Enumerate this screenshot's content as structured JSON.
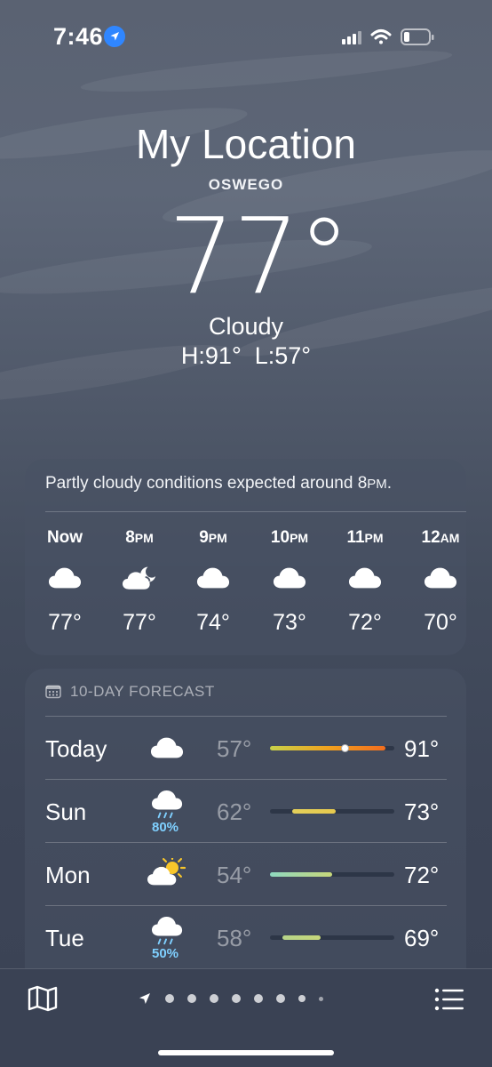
{
  "status_bar": {
    "time": "7:46",
    "location_icon": "location-arrow-icon",
    "signal_icon": "cellular-signal-icon",
    "wifi_icon": "wifi-icon",
    "battery_icon": "battery-low-icon"
  },
  "header": {
    "title": "My Location",
    "subtitle": "OSWEGO",
    "temperature": "77°",
    "condition": "Cloudy",
    "hi_lo": "H:91°  L:57°"
  },
  "hourly": {
    "summary": "Partly cloudy conditions expected around 8PM.",
    "hours": [
      {
        "label": "Now",
        "icon": "cloud-icon",
        "temp": "77°"
      },
      {
        "label": "8PM",
        "icon": "cloud-moon-icon",
        "temp": "77°"
      },
      {
        "label": "9PM",
        "icon": "cloud-icon",
        "temp": "74°"
      },
      {
        "label": "10PM",
        "icon": "cloud-icon",
        "temp": "73°"
      },
      {
        "label": "11PM",
        "icon": "cloud-icon",
        "temp": "72°"
      },
      {
        "label": "12AM",
        "icon": "cloud-icon",
        "temp": "70°"
      }
    ]
  },
  "forecast": {
    "header": "10-DAY FORECAST",
    "days": [
      {
        "day": "Today",
        "icon": "cloud-icon",
        "precip": "",
        "low": "57°",
        "high": "91°",
        "range": [
          0.0,
          0.93
        ],
        "current": 0.6,
        "colors": [
          "#c8d24a",
          "#f0a21e",
          "#f26d1e"
        ]
      },
      {
        "day": "Sun",
        "icon": "cloud-rain-icon",
        "precip": "80%",
        "low": "62°",
        "high": "73°",
        "range": [
          0.18,
          0.53
        ],
        "colors": [
          "#e3cf5a",
          "#e6c94e"
        ]
      },
      {
        "day": "Mon",
        "icon": "cloud-sun-icon",
        "precip": "",
        "low": "54°",
        "high": "72°",
        "range": [
          0.0,
          0.5
        ],
        "colors": [
          "#8fd9c0",
          "#c8d87a"
        ]
      },
      {
        "day": "Tue",
        "icon": "cloud-rain-icon",
        "precip": "50%",
        "low": "58°",
        "high": "69°",
        "range": [
          0.1,
          0.41
        ],
        "colors": [
          "#b6d489",
          "#c7d77a"
        ]
      }
    ]
  },
  "toolbar": {
    "map_icon": "map-icon",
    "list_icon": "list-icon",
    "page_count": 9,
    "current_page": 0
  }
}
